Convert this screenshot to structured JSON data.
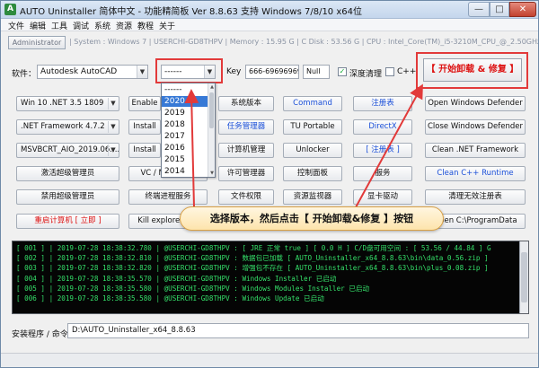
{
  "window": {
    "title": "AUTO Uninstaller 简体中文 - 功能精简板 Ver 8.8.63 支持 Windows 7/8/10 x64位",
    "min_glyph": "—",
    "max_glyph": "□",
    "close_glyph": "✕"
  },
  "menu": [
    "文件",
    "编辑",
    "工具",
    "调试",
    "系统",
    "资源",
    "教程",
    "关于"
  ],
  "infobar": {
    "admin_label": "Administrator",
    "system": "| System : Windows 7  |  USERCHI-GD8THPV  |  Memory : 15.95 G  |  C Disk : 53.56 G  |  CPU : Intel_Core(TM)_i5-3210M_CPU_@_2.50GHz"
  },
  "controls": {
    "software_label": "软件：",
    "software_value": "Autodesk AutoCAD",
    "version_value": "------",
    "key_label": "Key",
    "key_value": "666-69696969",
    "null_value": "Null",
    "deep_clean_label": "深度清理",
    "deep_clean_checked": "✓",
    "cpp_label": "C++",
    "start_button": "【  开始卸载 & 修复  】"
  },
  "version_dropdown": {
    "items": [
      "------",
      "2020",
      "2019",
      "2018",
      "2017",
      "2016",
      "2015",
      "2014"
    ],
    "selected_index": 1,
    "up": "▲",
    "down": "▼"
  },
  "buttons": {
    "r1": [
      "Win 10 .NET 3.5 1809",
      "Enable",
      "系统版本",
      "Command",
      "注册表",
      "Open Windows Defender"
    ],
    "r2": [
      ".NET Framework 4.7.2",
      "Install",
      "任务管理器",
      "TU Portable",
      "DirectX",
      "Close Windows Defender"
    ],
    "r3": [
      "MSVBCRT_AIO_2019.06....",
      "Install",
      "计算机管理",
      "Unlocker",
      "[ 注册表 ]",
      "Clean .NET Framework"
    ],
    "r4": [
      "激活超级管理员",
      "VC / MS Install",
      "许可管理器",
      "控制面板",
      "服务",
      "Clean C++ Runtime"
    ],
    "r5": [
      "禁用超级管理员",
      "终端进程服务",
      "文件权限",
      "资源监视器",
      "显卡驱动",
      "清理无效注册表"
    ],
    "r6": [
      "重启计算机 [ 立即 ]",
      "Kill explorer.exe",
      "Open C:\\ProgramData"
    ]
  },
  "callout": "选择版本，然后点击【 开始卸载&修复 】按钮",
  "log": [
    "[ 001 ] | 2019-07-28 18:38:32.780 | @USERCHI-GD8THPV : [ JRE 正常  true ] [ 0.0 H ] C/D盘可用空间 : [ 53.56 / 44.84 ] G",
    "[ 002 ] | 2019-07-28 18:38:32.810 | @USERCHI-GD8THPV : 数据包已加载 [ AUTO_Uninstaller_x64_8.8.63\\bin\\data_0.56.zip ]",
    "[ 003 ] | 2019-07-28 18:38:32.820 | @USERCHI-GD8THPV : 增强包不存在 [ AUTO_Uninstaller_x64_8.8.63\\bin\\plus_0.08.zip ]",
    "[ 004 ] | 2019-07-28 18:38:35.570 | @USERCHI-GD8THPV : Windows Installer 已启动",
    "[ 005 ] | 2019-07-28 18:38:35.580 | @USERCHI-GD8THPV : Windows Modules Installer 已启动",
    "[ 006 ] | 2019-07-28 18:38:35.580 | @USERCHI-GD8THPV : Windows Update 已启动"
  ],
  "path": {
    "label": "安装程序 / 命令",
    "value": "D:\\AUTO_Uninstaller_x64_8.8.63"
  },
  "colors": {
    "accent_red": "#e23a3a",
    "log_text": "#35e06a",
    "link_blue": "#1a4fd8"
  }
}
